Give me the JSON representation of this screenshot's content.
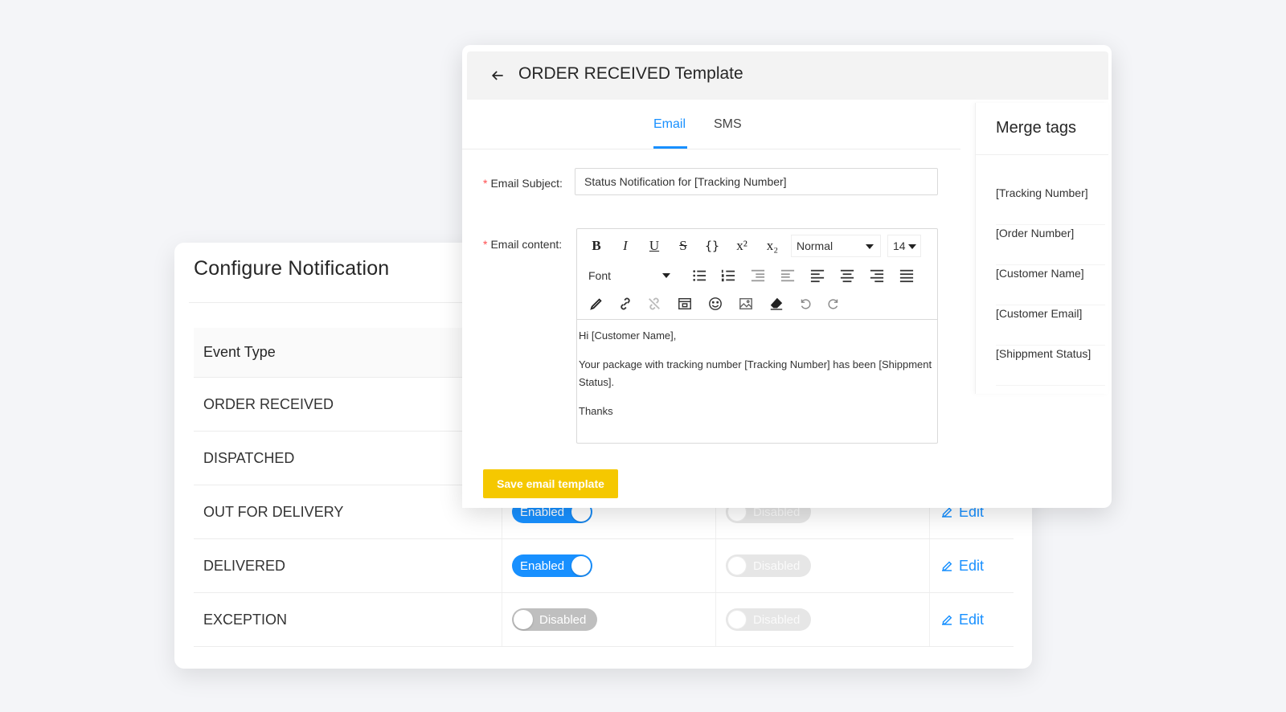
{
  "config": {
    "title": "Configure Notification",
    "table": {
      "header": "Event Type",
      "rows": [
        {
          "event": "ORDER RECEIVED"
        },
        {
          "event": "DISPATCHED"
        },
        {
          "event": "OUT FOR DELIVERY",
          "email_toggle": "Enabled",
          "sms_toggle": "Disabled",
          "action": "Edit"
        },
        {
          "event": "DELIVERED",
          "email_toggle": "Enabled",
          "sms_toggle": "Disabled",
          "action": "Edit"
        },
        {
          "event": "EXCEPTION",
          "email_toggle": "Disabled",
          "sms_toggle": "Disabled",
          "action": "Edit"
        }
      ]
    }
  },
  "template": {
    "title": "ORDER RECEIVED Template",
    "tabs": [
      {
        "label": "Email",
        "active": true
      },
      {
        "label": "SMS",
        "active": false
      }
    ],
    "subject_label": "Email Subject:",
    "subject_value": "Status Notification for [Tracking Number]",
    "content_label": "Email content:",
    "toolbar": {
      "heading_select": "Normal",
      "size_select": "14",
      "font_select": "Font"
    },
    "body": {
      "line1": "Hi  [Customer Name],",
      "line2": "Your package with tracking number  [Tracking Number] has been [Shippment Status].",
      "line3": "Thanks"
    },
    "save_label": "Save email template"
  },
  "merge": {
    "title": "Merge tags",
    "items": [
      "[Tracking Number]",
      "[Order Number]",
      "[Customer Name]",
      "[Customer Email]",
      "[Shippment Status]"
    ]
  },
  "colors": {
    "accent": "#1890ff",
    "save": "#f5c800",
    "required": "#ff4d4f"
  }
}
